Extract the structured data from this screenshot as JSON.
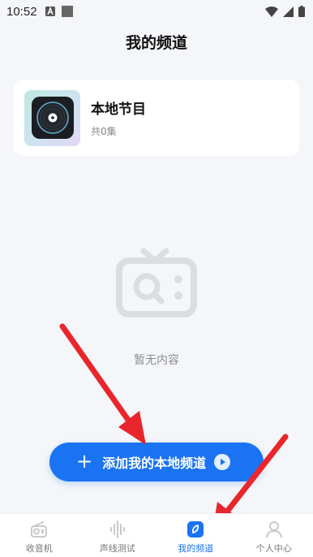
{
  "status_bar": {
    "time": "10:52"
  },
  "header": {
    "title": "我的频道"
  },
  "program_card": {
    "title": "本地节目",
    "subtitle": "共0集",
    "icon": "vinyl-record-icon"
  },
  "empty_state": {
    "text": "暂无内容",
    "icon": "tv-search-icon"
  },
  "add_button": {
    "label": "添加我的本地频道"
  },
  "tab_bar": {
    "tabs": [
      {
        "label": "收音机",
        "icon": "radio-icon",
        "active": false
      },
      {
        "label": "声线测试",
        "icon": "soundwave-icon",
        "active": false
      },
      {
        "label": "我的频道",
        "icon": "my-channel-icon",
        "active": true
      },
      {
        "label": "个人中心",
        "icon": "profile-icon",
        "active": false
      }
    ]
  },
  "colors": {
    "accent": "#1a73f2",
    "background": "#f4f6f9",
    "annotation_arrow": "#e8262b"
  }
}
